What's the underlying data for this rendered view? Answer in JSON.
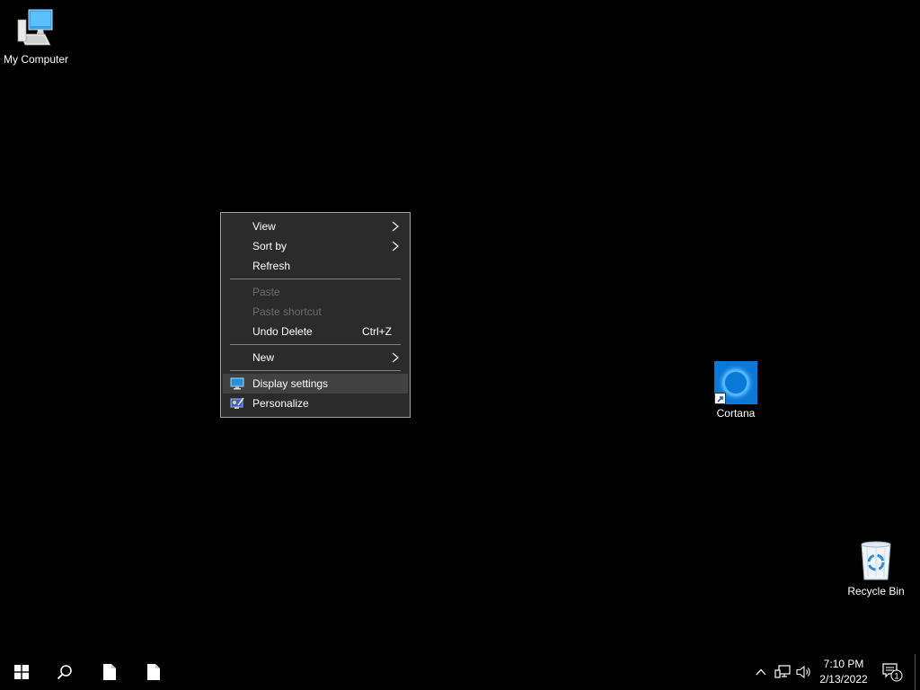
{
  "desktop": {
    "icons": [
      {
        "label": "My Computer",
        "icon": "computer-icon"
      },
      {
        "label": "Cortana",
        "icon": "cortana-icon"
      },
      {
        "label": "Recycle Bin",
        "icon": "recycle-bin-icon"
      }
    ]
  },
  "context_menu": {
    "items": [
      {
        "label": "View",
        "submenu": true,
        "enabled": true
      },
      {
        "label": "Sort by",
        "submenu": true,
        "enabled": true
      },
      {
        "label": "Refresh",
        "enabled": true
      },
      {
        "label": "Paste",
        "enabled": false
      },
      {
        "label": "Paste shortcut",
        "enabled": false
      },
      {
        "label": "Undo Delete",
        "shortcut": "Ctrl+Z",
        "enabled": true
      },
      {
        "label": "New",
        "submenu": true,
        "enabled": true
      },
      {
        "label": "Display settings",
        "icon": "display-settings-icon",
        "enabled": true,
        "highlighted": true
      },
      {
        "label": "Personalize",
        "icon": "personalize-icon",
        "enabled": true
      }
    ]
  },
  "taskbar": {
    "buttons": [
      {
        "name": "start",
        "icon": "windows-logo-icon"
      },
      {
        "name": "search",
        "icon": "search-icon"
      },
      {
        "name": "app-1",
        "icon": "document-icon"
      },
      {
        "name": "app-2",
        "icon": "document-icon"
      }
    ],
    "tray": {
      "time": "7:10 PM",
      "date": "2/13/2022",
      "notification_count": "1",
      "icons": [
        "chevron-up-icon",
        "network-icon",
        "volume-icon",
        "notification-icon"
      ]
    }
  },
  "colors": {
    "desktop_bg": "#000000",
    "menu_bg": "#2b2b2b",
    "menu_hover": "#414141",
    "menu_disabled_text": "#6d6d6d",
    "accent_blue": "#0a78d7"
  }
}
